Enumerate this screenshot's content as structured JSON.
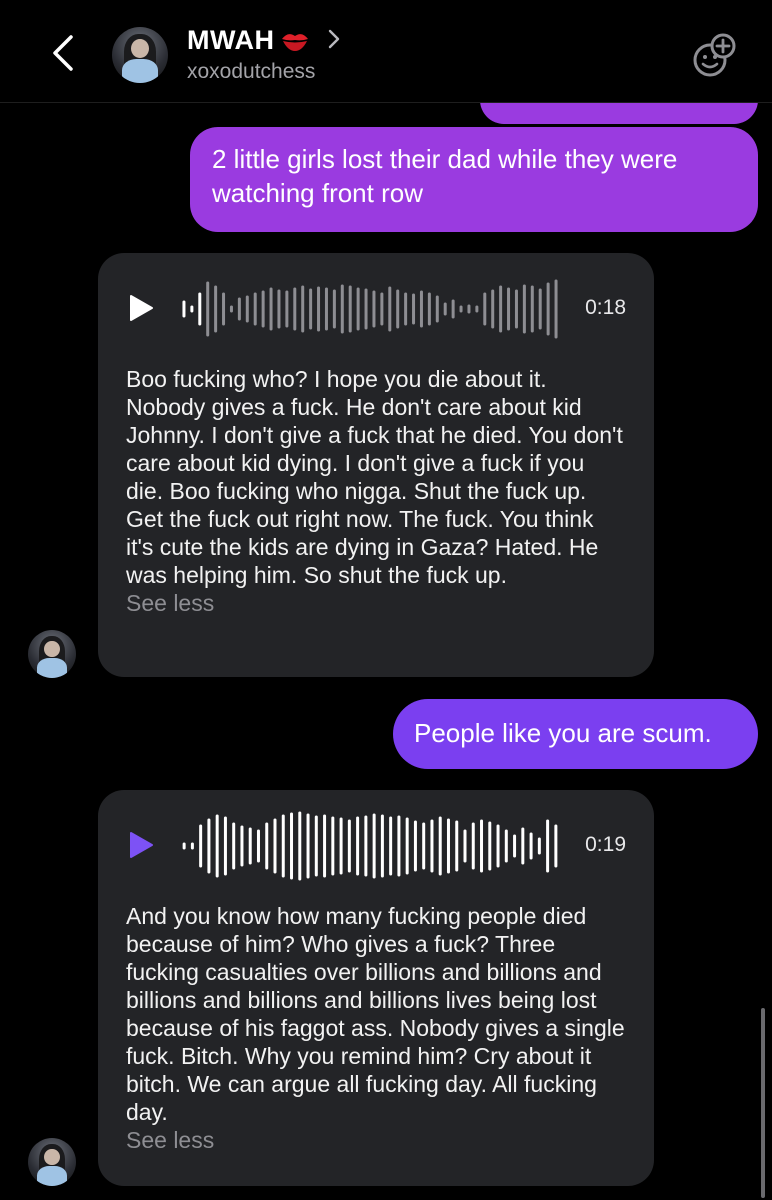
{
  "header": {
    "name": "MWAH",
    "username": "xoxodutchess"
  },
  "messages": [
    {
      "type": "sent",
      "text": "2 little girls lost their dad while they were watching front row"
    },
    {
      "type": "voice_received",
      "duration": "0:18",
      "waveform": [
        14,
        0,
        30,
        52,
        44,
        30,
        0,
        20,
        24,
        30,
        34,
        40,
        36,
        34,
        40,
        44,
        38,
        42,
        40,
        36,
        46,
        44,
        40,
        38,
        34,
        30,
        42,
        36,
        30,
        28,
        34,
        30,
        24,
        10,
        16,
        0,
        6,
        0,
        30,
        36,
        44,
        40,
        36,
        46,
        44,
        38,
        50,
        56
      ],
      "transcript": "Boo fucking who? I hope you die about it. Nobody gives a fuck. He don't care about kid Johnny. I don't give a fuck that he died. You don't care about kid dying. I don't give a fuck if you die. Boo fucking who nigga. Shut the fuck up. Get the fuck out right now. The fuck. You think it's cute the kids are dying in Gaza? Hated. He was helping him. So shut the fuck up.",
      "see_less": "See less",
      "played": false
    },
    {
      "type": "sent",
      "text": "People like you are scum."
    },
    {
      "type": "voice_received",
      "duration": "0:19",
      "waveform": [
        4,
        0,
        40,
        52,
        60,
        56,
        44,
        38,
        34,
        30,
        44,
        52,
        60,
        64,
        66,
        62,
        58,
        60,
        56,
        54,
        50,
        56,
        58,
        62,
        60,
        56,
        58,
        54,
        48,
        44,
        50,
        56,
        52,
        48,
        30,
        44,
        50,
        46,
        40,
        30,
        20,
        34,
        24,
        14,
        50,
        40
      ],
      "transcript": "And you know how many fucking people died because of him? Who gives a fuck? Three fucking casualties over billions and billions and billions and billions and billions lives being lost because of his faggot ass. Nobody gives a single fuck. Bitch. Why you remind him? Cry about it bitch. We can argue all fucking day. All fucking day.",
      "see_less": "See less",
      "played": true
    }
  ],
  "colors": {
    "background": "#000000",
    "sent_bubble": "#9a3be0",
    "sent_bubble_alt": "#7b3ff0",
    "received_bubble": "#232427",
    "played_icon": "#7d52f5",
    "secondary_text": "#a3a3a8"
  },
  "icons": {
    "back": "chevron-left-icon",
    "profile_arrow": "chevron-right-icon",
    "name_emoji": "kiss-mark-icon",
    "add_reaction": "add-emoji-icon",
    "play": "play-icon"
  }
}
